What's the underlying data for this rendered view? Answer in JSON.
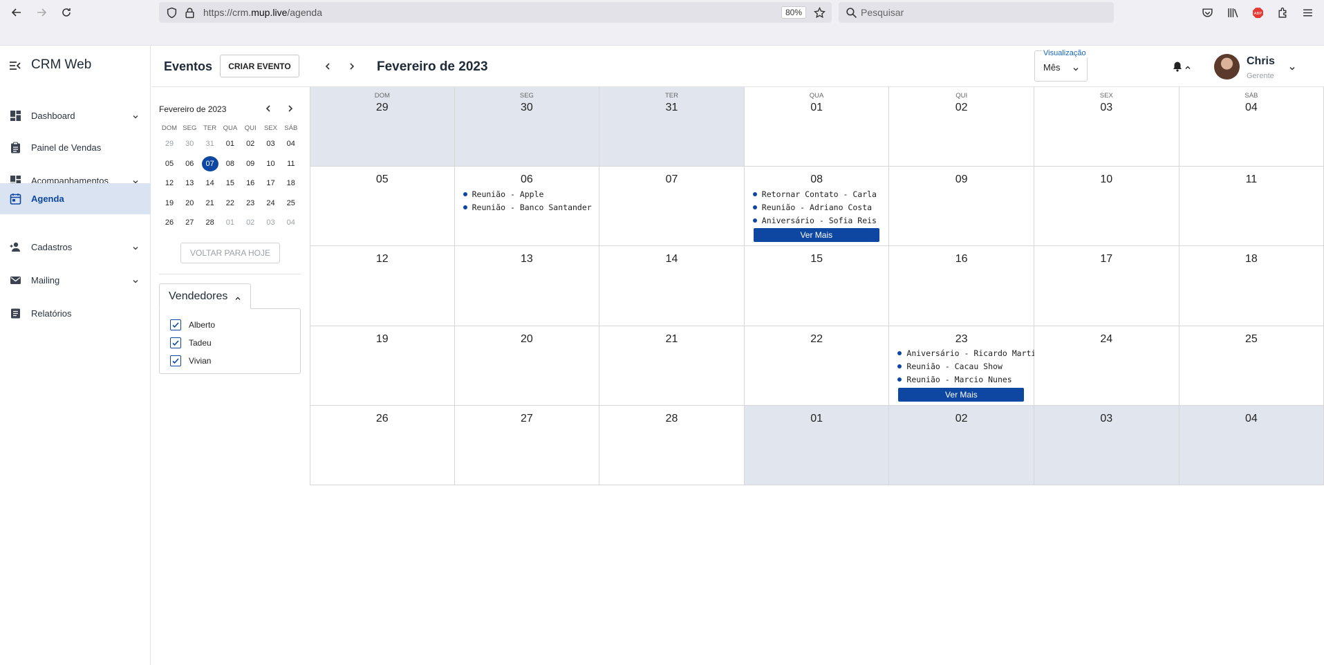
{
  "browser": {
    "url_prefix": "https://crm.",
    "url_domain": "mup.live",
    "url_path": "/agenda",
    "zoom": "80%",
    "search_placeholder": "Pesquisar"
  },
  "sidebar": {
    "brand": "CRM Web",
    "items": [
      {
        "label": "Dashboard",
        "icon": "dashboard-icon",
        "expandable": true
      },
      {
        "label": "Painel de Vendas",
        "icon": "clipboard-icon",
        "expandable": false
      },
      {
        "label": "Acompanhamentos",
        "icon": "dashboard-icon",
        "expandable": true
      },
      {
        "label": "Agenda",
        "icon": "calendar-icon",
        "expandable": false,
        "active": true
      },
      {
        "label": "Cadastros",
        "icon": "person-add-icon",
        "expandable": true
      },
      {
        "label": "Mailing",
        "icon": "mail-icon",
        "expandable": true
      },
      {
        "label": "Relatórios",
        "icon": "report-icon",
        "expandable": false
      }
    ]
  },
  "header": {
    "title": "Eventos",
    "create_button": "CRIAR EVENTO",
    "month_title": "Fevereiro de 2023",
    "view_label": "Visualização",
    "view_value": "Mês",
    "user_name": "Chris",
    "user_role": "Gerente"
  },
  "mini_calendar": {
    "title": "Fevereiro de 2023",
    "weekdays": [
      "DOM",
      "SEG",
      "TER",
      "QUA",
      "QUI",
      "SEX",
      "SÁB"
    ],
    "weeks": [
      [
        {
          "d": "29",
          "m": true
        },
        {
          "d": "30",
          "m": true
        },
        {
          "d": "31",
          "m": true
        },
        {
          "d": "01"
        },
        {
          "d": "02"
        },
        {
          "d": "03"
        },
        {
          "d": "04"
        }
      ],
      [
        {
          "d": "05"
        },
        {
          "d": "06"
        },
        {
          "d": "07",
          "sel": true
        },
        {
          "d": "08"
        },
        {
          "d": "09"
        },
        {
          "d": "10"
        },
        {
          "d": "11"
        }
      ],
      [
        {
          "d": "12"
        },
        {
          "d": "13"
        },
        {
          "d": "14"
        },
        {
          "d": "15"
        },
        {
          "d": "16"
        },
        {
          "d": "17"
        },
        {
          "d": "18"
        }
      ],
      [
        {
          "d": "19"
        },
        {
          "d": "20"
        },
        {
          "d": "21"
        },
        {
          "d": "22"
        },
        {
          "d": "23"
        },
        {
          "d": "24"
        },
        {
          "d": "25"
        }
      ],
      [
        {
          "d": "26"
        },
        {
          "d": "27"
        },
        {
          "d": "28"
        },
        {
          "d": "01",
          "m": true
        },
        {
          "d": "02",
          "m": true
        },
        {
          "d": "03",
          "m": true
        },
        {
          "d": "04",
          "m": true
        }
      ]
    ],
    "today_button": "VOLTAR PARA HOJE"
  },
  "sellers": {
    "title": "Vendedores",
    "items": [
      {
        "name": "Alberto",
        "checked": true
      },
      {
        "name": "Tadeu",
        "checked": true
      },
      {
        "name": "Vivian",
        "checked": true
      }
    ]
  },
  "calendar": {
    "weekdays": [
      "DOM",
      "SEG",
      "TER",
      "QUA",
      "QUI",
      "SEX",
      "SÁB"
    ],
    "more_label": "Ver Mais",
    "weeks": [
      [
        {
          "d": "29",
          "out": true
        },
        {
          "d": "30",
          "out": true
        },
        {
          "d": "31",
          "out": true
        },
        {
          "d": "01"
        },
        {
          "d": "02"
        },
        {
          "d": "03"
        },
        {
          "d": "04"
        }
      ],
      [
        {
          "d": "05"
        },
        {
          "d": "06",
          "events": [
            "Reunião - Apple",
            "Reunião - Banco Santander"
          ]
        },
        {
          "d": "07"
        },
        {
          "d": "08",
          "events": [
            "Retornar Contato - Carla",
            "Reunião - Adriano Costa",
            "Aniversário - Sofia Reis"
          ],
          "more": true
        },
        {
          "d": "09"
        },
        {
          "d": "10"
        },
        {
          "d": "11"
        }
      ],
      [
        {
          "d": "12"
        },
        {
          "d": "13"
        },
        {
          "d": "14"
        },
        {
          "d": "15"
        },
        {
          "d": "16"
        },
        {
          "d": "17"
        },
        {
          "d": "18"
        }
      ],
      [
        {
          "d": "19"
        },
        {
          "d": "20"
        },
        {
          "d": "21"
        },
        {
          "d": "22"
        },
        {
          "d": "23",
          "events": [
            "Aniversário - Ricardo Martins",
            "Reunião - Cacau Show",
            "Reunião - Marcio Nunes"
          ],
          "more": true
        },
        {
          "d": "24"
        },
        {
          "d": "25"
        }
      ],
      [
        {
          "d": "26"
        },
        {
          "d": "27"
        },
        {
          "d": "28"
        },
        {
          "d": "01",
          "out": true
        },
        {
          "d": "02",
          "out": true
        },
        {
          "d": "03",
          "out": true
        },
        {
          "d": "04",
          "out": true
        }
      ]
    ]
  },
  "colors": {
    "accent": "#0d47a1",
    "active_bg": "#d9e3f1",
    "out_month_bg": "#e1e6ee"
  }
}
